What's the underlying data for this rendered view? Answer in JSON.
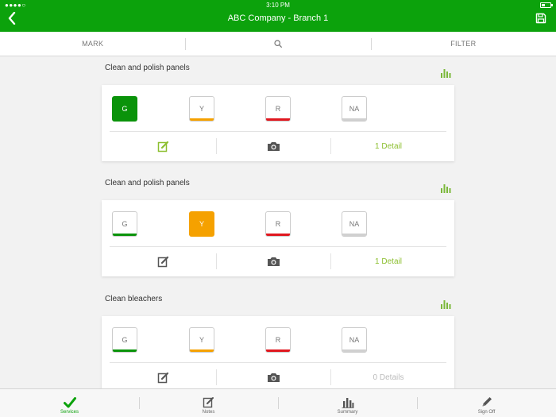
{
  "status": {
    "signal": "●●●●○",
    "time": "3:10 PM"
  },
  "nav": {
    "title": "ABC Company - Branch 1",
    "back_icon": "chevron-left-icon",
    "save_icon": "floppy-disk-icon"
  },
  "toolbar": {
    "mark_label": "MARK",
    "search_icon": "search-icon",
    "filter_label": "FILTER"
  },
  "colors": {
    "brand": "#0ca20c",
    "green": "#0a930a",
    "yellow": "#f5a100",
    "red": "#e0171f",
    "na": "#d0d0d0",
    "detail_active": "#8cbf2f",
    "detail_inactive": "#bbbbbb",
    "edit_active": "#8cbf2f",
    "edit_inactive": "#555555"
  },
  "sections": [
    {
      "title": "Clean and polish panels",
      "grades": [
        {
          "label": "G",
          "selected": true
        },
        {
          "label": "Y",
          "selected": false
        },
        {
          "label": "R",
          "selected": false
        },
        {
          "label": "NA",
          "selected": false
        }
      ],
      "detail": "1 Detail",
      "detail_active": true,
      "edit_active": true
    },
    {
      "title": "Clean and polish panels",
      "grades": [
        {
          "label": "G",
          "selected": false
        },
        {
          "label": "Y",
          "selected": true
        },
        {
          "label": "R",
          "selected": false
        },
        {
          "label": "NA",
          "selected": false
        }
      ],
      "detail": "1 Detail",
      "detail_active": true,
      "edit_active": false
    },
    {
      "title": "Clean bleachers",
      "grades": [
        {
          "label": "G",
          "selected": false
        },
        {
          "label": "Y",
          "selected": false
        },
        {
          "label": "R",
          "selected": false
        },
        {
          "label": "NA",
          "selected": false
        }
      ],
      "detail": "0 Details",
      "detail_active": false,
      "edit_active": false
    }
  ],
  "tabs": [
    {
      "label": "Services",
      "icon": "checkmark-icon",
      "active": true
    },
    {
      "label": "Notes",
      "icon": "notes-icon",
      "active": false
    },
    {
      "label": "Summary",
      "icon": "bar-chart-icon",
      "active": false
    },
    {
      "label": "Sign Off",
      "icon": "pencil-icon",
      "active": false
    }
  ]
}
